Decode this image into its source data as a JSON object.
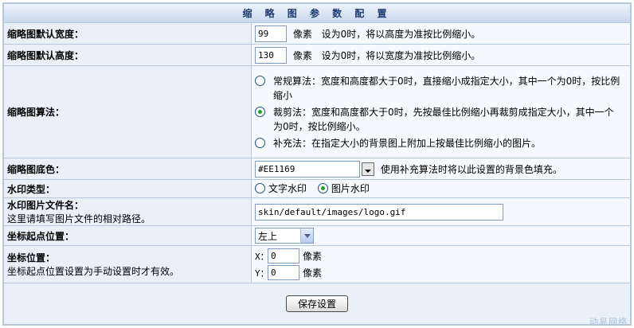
{
  "header": {
    "title": "缩 略 图 参 数 配 置"
  },
  "width": {
    "label": "缩略图默认宽度：",
    "value": "99",
    "unit": "像素",
    "hint": "设为0时，将以高度为准按比例缩小。"
  },
  "height": {
    "label": "缩略图默认高度：",
    "value": "130",
    "unit": "像素",
    "hint": "设为0时，将以宽度为准按比例缩小。"
  },
  "algorithm": {
    "label": "缩略图算法：",
    "options": [
      {
        "text": "常规算法：宽度和高度都大于0时，直接缩小成指定大小，其中一个为0时，按比例缩小",
        "selected": false
      },
      {
        "text": "裁剪法：宽度和高度都大于0时，先按最佳比例缩小再裁剪成指定大小，其中一个为0时，按比例缩小。",
        "selected": true
      },
      {
        "text": "补充法：在指定大小的背景图上附加上按最佳比例缩小的图片。",
        "selected": false
      }
    ]
  },
  "bgcolor": {
    "label": "缩略图底色：",
    "value": "#EE1169",
    "hint": "使用补充算法时将以此设置的背景色填充。"
  },
  "watermark_type": {
    "label": "水印类型：",
    "options": [
      {
        "text": "文字水印",
        "selected": false
      },
      {
        "text": "图片水印",
        "selected": true
      }
    ]
  },
  "watermark_file": {
    "label": "水印图片文件名：",
    "sublabel": "这里请填写图片文件的相对路径。",
    "value": "skin/default/images/logo.gif"
  },
  "origin": {
    "label": "坐标起点位置：",
    "selected": "左上"
  },
  "position": {
    "label": "坐标位置：",
    "sublabel": "坐标起点位置设置为手动设置时才有效。",
    "x_label": "X：",
    "x_value": "0",
    "y_label": "Y：",
    "y_value": "0",
    "unit": "像素"
  },
  "save_label": "保存设置",
  "watermark_text": "动易网络",
  "colors": {
    "header_text": "#1c3b74",
    "border": "#b5c8dd",
    "label_bg": "#eaf0f8",
    "value_bg": "#f6f9fd",
    "radio_dot": "#21a121"
  }
}
